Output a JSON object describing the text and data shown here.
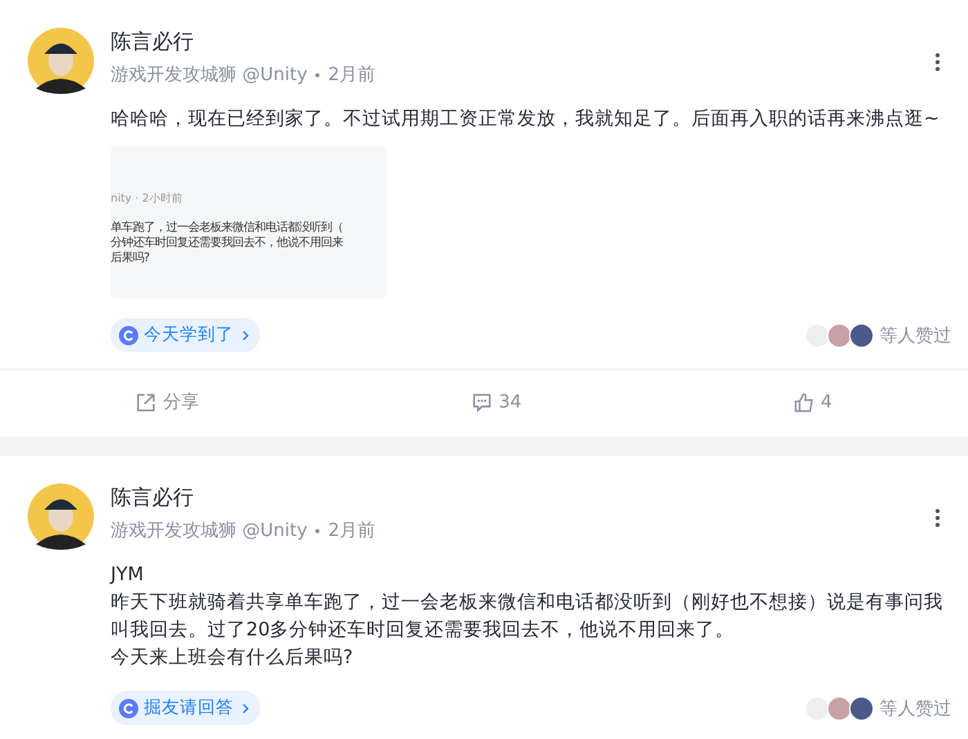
{
  "posts": [
    {
      "author": "陈言必行",
      "title": "游戏开发攻城狮 @Unity",
      "time": "2月前",
      "body": [
        "哈哈哈，现在已经到家了。不过试用期工资正常发放，我就知足了。后面再入职的话再来沸点逛~"
      ],
      "image": {
        "kind": "screenshot",
        "meta": "nity · 2小时前",
        "lines": [
          "单车跑了，过一会老板来微信和电话都没听到（",
          "分钟还车时回复还需要我回去不，他说不用回来",
          "后果吗?"
        ]
      },
      "tag": "今天学到了",
      "likers_text": "等人赞过",
      "actions": {
        "share": "分享",
        "comments": "34",
        "likes": "4"
      }
    },
    {
      "author": "陈言必行",
      "title": "游戏开发攻城狮 @Unity",
      "time": "2月前",
      "body": [
        "JYM",
        "昨天下班就骑着共享单车跑了，过一会老板来微信和电话都没听到（刚好也不想接）说是有事问我叫我回去。过了20多分钟还车时回复还需要我回去不，他说不用回来了。",
        "今天来上班会有什么后果吗?"
      ],
      "tag": "掘友请回答",
      "likers_text": "等人赞过"
    }
  ]
}
